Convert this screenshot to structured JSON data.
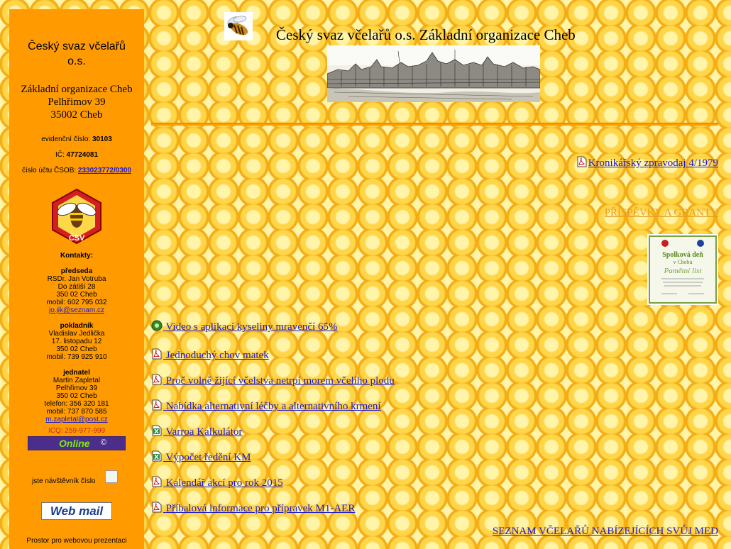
{
  "sidebar": {
    "title_line1": "Český svaz včelařů",
    "title_line2": "o.s.",
    "addr_line1": "Základní organizace Cheb",
    "addr_line2": "Pelhřimov 39",
    "addr_line3": "35002 Cheb",
    "evidence_label": "evidenční číslo: ",
    "evidence_value": "30103",
    "ic_label": "IČ: ",
    "ic_value": "47724081",
    "account_label": "číslo účtu ČSOB: ",
    "account_value": "233023772/0300",
    "logo_letters": "ČSV",
    "contacts_heading": "Kontakty:",
    "chair": {
      "role": "předseda",
      "name": "RSDr. Jan Votruba",
      "street": "Do zátiší 28",
      "city": "350 02 Cheb",
      "mobile": "mobil: 602 795 032",
      "email": "jo.jik@seznam.cz"
    },
    "treasurer": {
      "role": "pokladník",
      "name": "Vladislav Jedlička",
      "street": "17. listopadu 12",
      "city": "350 02 Cheb",
      "mobile": "mobil: 739 925 910"
    },
    "secretary": {
      "role": "jednatel",
      "name": "Martin Zapletal",
      "street": "Pelhřimov 39",
      "city": "350 02 Cheb",
      "phone": "telefon: 356 320 181",
      "mobile": "mobil: 737 870 585",
      "email": "m.zapletal@post.cz"
    },
    "icq": "ICQ: 259-977-999",
    "online_label": "Online",
    "online_copyright": "©",
    "visitor_text": "jste návštěvník číslo",
    "webmail_label": "Web mail",
    "footer_text": "Prostor pro webovou prezentaci"
  },
  "header": {
    "title": "Český svaz včelařů o.s. Základní organizace Cheb"
  },
  "links": {
    "kronika": "Kronikářský zpravodaj 4/1979",
    "grants": "PŘÍSPĚVKY A GRANTY",
    "certificate_texts": [
      "Spolková deň",
      "v Chebu",
      "Pamětní list"
    ],
    "items": [
      {
        "label": "Video s aplikací kyseliny mravenčí 65%",
        "icon": "video-icon"
      },
      {
        "label": "Jednoduchý chov matek",
        "icon": "pdf-icon"
      },
      {
        "label": "Proč volně žijící včelstva netrpí morem včelího plodu",
        "icon": "pdf-icon"
      },
      {
        "label": "Nabídka alternativní léčby a alternativního krmení",
        "icon": "pdf-icon"
      },
      {
        "label": "Varroa Kalkulátor",
        "icon": "excel-icon"
      },
      {
        "label": "Výpočet ředění KM",
        "icon": "excel-icon"
      },
      {
        "label": "Kalendář akcí pro rok 2015",
        "icon": "pdf-icon"
      },
      {
        "label": "Příbalová informace pro přípravek M1-AER",
        "icon": "pdf-icon"
      }
    ],
    "seznam": "SEZNAM VČELAŘŮ NABÍZEJÍCÍCH SVŮJ MED"
  },
  "colors": {
    "sidebar_bg": "#ff9b00",
    "link": "#1a1ad0",
    "grants_link": "#e89a20",
    "icq": "#c0281e",
    "online_bg": "#4b2d8c",
    "online_text": "#7cf000"
  }
}
